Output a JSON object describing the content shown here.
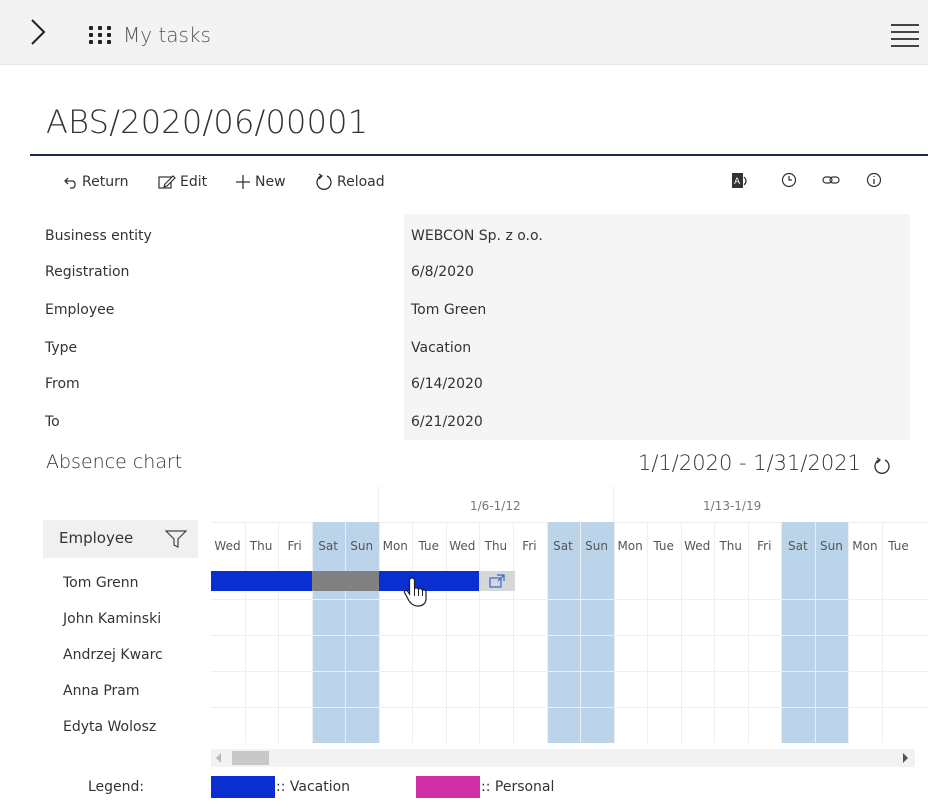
{
  "app": {
    "title": "My tasks"
  },
  "document": {
    "title": "ABS/2020/06/00001"
  },
  "toolbar": {
    "return_label": "Return",
    "edit_label": "Edit",
    "new_label": "New",
    "reload_label": "Reload",
    "right_icons": [
      "office-icon",
      "history-clock-icon",
      "link-icon",
      "info-icon"
    ]
  },
  "fields": [
    {
      "label": "Business entity",
      "value": "WEBCON Sp. z o.o."
    },
    {
      "label": "Registration",
      "value": "6/8/2020"
    },
    {
      "label": "Employee",
      "value": "Tom Green"
    },
    {
      "label": "Type",
      "value": "Vacation"
    },
    {
      "label": "From",
      "value": "6/14/2020"
    },
    {
      "label": "To",
      "value": "6/21/2020"
    }
  ],
  "absence_chart": {
    "title": "Absence chart",
    "range": "1/1/2020 - 1/31/2021",
    "week_labels": [
      "1/6-1/12",
      "1/13-1/19"
    ],
    "employee_header": "Employee",
    "days": [
      "Wed",
      "Thu",
      "Fri",
      "Sat",
      "Sun",
      "Mon",
      "Tue",
      "Wed",
      "Thu",
      "Fri",
      "Sat",
      "Sun",
      "Mon",
      "Tue",
      "Wed",
      "Thu",
      "Fri",
      "Sat",
      "Sun",
      "Mon",
      "Tue"
    ],
    "employees": [
      "Tom Grenn",
      "John Kaminski",
      "Andrzej Kwarc",
      "Anna Pram",
      "Edyta Wolosz"
    ],
    "legend": {
      "label": "Legend:",
      "items": [
        {
          "label": ":: Vacation",
          "color": "#0a2ed0"
        },
        {
          "label": ":: Personal",
          "color": "#d12fa8"
        }
      ]
    },
    "weekend_color": "#bcd4ea",
    "bar_color": "#0a2ed0",
    "weekend_bar_color": "#808080"
  }
}
